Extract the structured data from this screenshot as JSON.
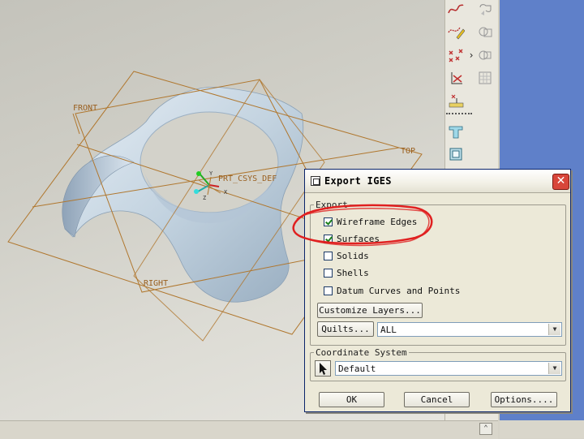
{
  "viewport": {
    "datum_labels": {
      "front": "FRONT",
      "top": "TOP",
      "right": "RIGHT"
    },
    "csys_label": "PRT_CSYS_DEF",
    "axis_labels": {
      "y": "Y",
      "x": "X",
      "z": "Z"
    }
  },
  "toolbar": {
    "icons": [
      "sketch-curve-icon",
      "datum-curve-icon",
      "datum-point-icon",
      "coordinate-system-icon",
      "analysis-icon",
      "flip-icon",
      "view-manager-icon",
      "copy-icon",
      "paste-icon",
      "grid-icon",
      "ruler-icon"
    ]
  },
  "dialog": {
    "title": "Export IGES",
    "close_symbol": "✕",
    "export_group": {
      "legend": "Export",
      "options": [
        {
          "label": "Wireframe Edges",
          "checked": true
        },
        {
          "label": "Surfaces",
          "checked": true
        },
        {
          "label": "Solids",
          "checked": false
        },
        {
          "label": "Shells",
          "checked": false
        },
        {
          "label": "Datum Curves and Points",
          "checked": false
        }
      ],
      "customize_layers_label": "Customize Layers...",
      "quilts_label": "Quilts...",
      "quilts_value": "ALL"
    },
    "coord_group": {
      "legend": "Coordinate System",
      "value": "Default"
    },
    "buttons": {
      "ok": "OK",
      "cancel": "Cancel",
      "options": "Options...."
    }
  },
  "status": {
    "scroll_symbol": "⌃"
  },
  "colors": {
    "datum": "#b0772e",
    "surface": "#c4d5e2",
    "highlight_ellipse": "#e02020",
    "title_bar_accent": "#0a246a"
  }
}
